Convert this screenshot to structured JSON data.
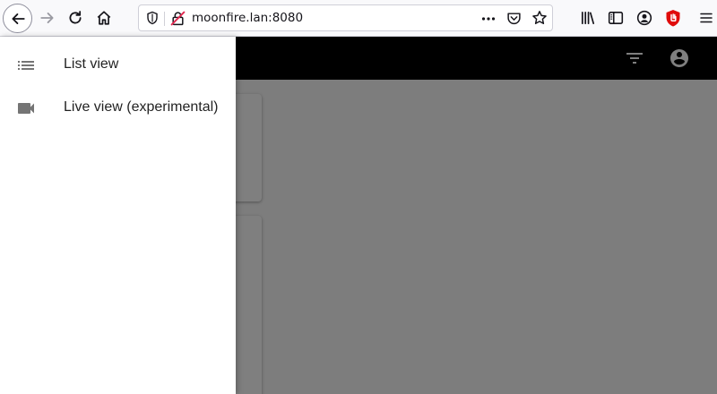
{
  "browser": {
    "url": "moonfire.lan:8080",
    "toolbar_icons": {
      "back": "arrow-left-icon",
      "forward": "arrow-right-icon",
      "reload": "reload-icon",
      "home": "home-icon",
      "tracking_protection": "shield-icon",
      "connection": "insecure-lock-icon",
      "page_actions": "ellipsis-icon",
      "pocket": "pocket-icon",
      "bookmark": "star-icon",
      "library": "library-icon",
      "sidebar": "sidebar-icon",
      "account": "account-icon",
      "extension": "ublock-icon",
      "menu": "hamburger-menu-icon"
    }
  },
  "app": {
    "appbar_color": "#000000",
    "scrim_color": "rgba(0,0,0,0.5)",
    "filter_icon": "filter-list-icon",
    "account_icon": "account-circle-icon"
  },
  "drawer": {
    "items": [
      {
        "label": "List view",
        "icon": "list-icon"
      },
      {
        "label": "Live view (experimental)",
        "icon": "videocam-icon"
      }
    ]
  }
}
